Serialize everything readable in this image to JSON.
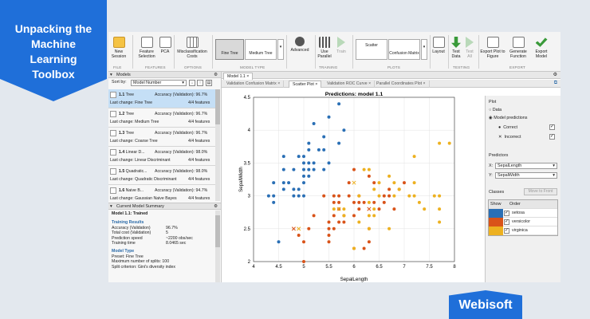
{
  "banner": {
    "title_lines": [
      "Unpacking the",
      "Machine",
      "Learning",
      "Toolbox"
    ]
  },
  "brand": {
    "name": "Webisoft"
  },
  "ribbon": {
    "buttons": {
      "new_session": "New Session",
      "feature_selection": "Feature Selection",
      "pca": "PCA",
      "misclassification_costs": "Misclassification Costs",
      "fine_tree": "Fine Tree",
      "medium_tree": "Medium Tree",
      "advanced": "Advanced",
      "use_parallel": "Use Parallel",
      "train": "Train",
      "scatter": "Scatter",
      "confusion_matrix": "Confusion Matrix",
      "layout": "Layout",
      "test_data": "Test Data",
      "test_all": "Test All",
      "export_plot": "Export Plot to Figure",
      "generate_function": "Generate Function",
      "export_model": "Export Model"
    },
    "sections": {
      "file": "FILE",
      "features": "FEATURES",
      "options": "OPTIONS",
      "model_type": "MODEL TYPE",
      "training": "TRAINING",
      "plots": "PLOTS",
      "testing": "TESTING",
      "export": "EXPORT"
    }
  },
  "models_panel": {
    "title": "Models",
    "sort_label": "Sort by:",
    "sort_value": "Model Number",
    "items": [
      {
        "id": "1.1",
        "name": "Tree",
        "accuracy": "Accuracy (Validation): 96.7%",
        "last": "Last change: Fine Tree",
        "features": "4/4 features"
      },
      {
        "id": "1.2",
        "name": "Tree",
        "accuracy": "Accuracy (Validation): 96.7%",
        "last": "Last change: Medium Tree",
        "features": "4/4 features"
      },
      {
        "id": "1.3",
        "name": "Tree",
        "accuracy": "Accuracy (Validation): 96.7%",
        "last": "Last change: Coarse Tree",
        "features": "4/4 features"
      },
      {
        "id": "1.4",
        "name": "Linear D...",
        "accuracy": "Accuracy (Validation): 98.0%",
        "last": "Last change: Linear Discriminant",
        "features": "4/4 features"
      },
      {
        "id": "1.5",
        "name": "Quadratic...",
        "accuracy": "Accuracy (Validation): 98.0%",
        "last": "Last change: Quadratic Discriminant",
        "features": "4/4 features"
      },
      {
        "id": "1.6",
        "name": "Naive B...",
        "accuracy": "Accuracy (Validation): 94.7%",
        "last": "Last change: Gaussian Naive Bayes",
        "features": "4/4 features"
      }
    ]
  },
  "summary": {
    "title": "Current Model Summary",
    "model_line": "Model 1.1: Trained",
    "training_results": "Training Results",
    "rows": [
      {
        "label": "Accuracy (Validation)",
        "value": "96.7%"
      },
      {
        "label": "Total cost (Validation)",
        "value": "5"
      },
      {
        "label": "Prediction speed",
        "value": "~2200 obs/sec"
      },
      {
        "label": "Training time",
        "value": "8.0465 sec"
      }
    ],
    "model_type": "Model Type",
    "preset": "Preset: Fine Tree",
    "max_splits": "Maximum number of splits: 100",
    "split_criterion": "Split criterion: Gini's diversity index"
  },
  "doc_tabs": {
    "model": "Model 1.1"
  },
  "plot_tabs": [
    "Validation Confusion Matrix",
    "Scatter Plot",
    "Validation ROC Curve",
    "Parallel Coordinates Plot"
  ],
  "plot_options": {
    "plot_heading": "Plot",
    "data": "Data",
    "predictions": "Model predictions",
    "correct": "Correct",
    "incorrect": "Incorrect",
    "predictors_heading": "Predictors",
    "x_label": "X:",
    "x_value": "SepalLength",
    "y_label": "Y:",
    "y_value": "SepalWidth",
    "classes_heading": "Classes",
    "move_to_front": "Move to Front",
    "show_col": "Show",
    "order_col": "Order",
    "classes": [
      "setosa",
      "versicolor",
      "virginica"
    ]
  },
  "colors": {
    "setosa": "#2a6fb5",
    "versicolor": "#d95319",
    "virginica": "#edb120"
  },
  "chart_data": {
    "type": "scatter",
    "title": "Predictions: model 1.1",
    "xlabel": "SepalLength",
    "ylabel": "SepalWidth",
    "xlim": [
      4,
      8
    ],
    "ylim": [
      2,
      4.5
    ],
    "xticks": [
      "4",
      "4.5",
      "5",
      "5.5",
      "6",
      "6.5",
      "7",
      "7.5",
      "8"
    ],
    "yticks": [
      "2",
      "2.5",
      "3",
      "3.5",
      "4",
      "4.5"
    ],
    "grid": true,
    "series": [
      {
        "name": "setosa",
        "points": [
          [
            4.3,
            3.0
          ],
          [
            4.4,
            2.9
          ],
          [
            4.4,
            3.0
          ],
          [
            4.4,
            3.2
          ],
          [
            4.5,
            2.3
          ],
          [
            4.6,
            3.1
          ],
          [
            4.6,
            3.2
          ],
          [
            4.6,
            3.4
          ],
          [
            4.6,
            3.6
          ],
          [
            4.7,
            3.2
          ],
          [
            4.8,
            3.0
          ],
          [
            4.8,
            3.1
          ],
          [
            4.8,
            3.4
          ],
          [
            4.9,
            3.0
          ],
          [
            4.9,
            3.1
          ],
          [
            4.9,
            3.6
          ],
          [
            5.0,
            3.0
          ],
          [
            5.0,
            3.2
          ],
          [
            5.0,
            3.3
          ],
          [
            5.0,
            3.4
          ],
          [
            5.0,
            3.5
          ],
          [
            5.0,
            3.6
          ],
          [
            5.1,
            3.3
          ],
          [
            5.1,
            3.4
          ],
          [
            5.1,
            3.5
          ],
          [
            5.1,
            3.7
          ],
          [
            5.1,
            3.8
          ],
          [
            5.2,
            3.4
          ],
          [
            5.2,
            3.5
          ],
          [
            5.2,
            4.1
          ],
          [
            5.3,
            3.7
          ],
          [
            5.4,
            3.4
          ],
          [
            5.4,
            3.7
          ],
          [
            5.4,
            3.9
          ],
          [
            5.5,
            3.5
          ],
          [
            5.5,
            4.2
          ],
          [
            5.7,
            3.8
          ],
          [
            5.7,
            4.4
          ],
          [
            5.8,
            4.0
          ]
        ]
      },
      {
        "name": "versicolor",
        "points": [
          [
            4.9,
            2.4
          ],
          [
            5.0,
            2.0
          ],
          [
            5.0,
            2.3
          ],
          [
            5.1,
            2.5
          ],
          [
            5.2,
            2.7
          ],
          [
            5.4,
            3.0
          ],
          [
            5.5,
            2.3
          ],
          [
            5.5,
            2.4
          ],
          [
            5.5,
            2.5
          ],
          [
            5.5,
            2.6
          ],
          [
            5.6,
            2.5
          ],
          [
            5.6,
            2.7
          ],
          [
            5.6,
            2.9
          ],
          [
            5.6,
            3.0
          ],
          [
            5.7,
            2.6
          ],
          [
            5.7,
            2.8
          ],
          [
            5.7,
            2.9
          ],
          [
            5.7,
            3.0
          ],
          [
            5.8,
            2.6
          ],
          [
            5.8,
            2.7
          ],
          [
            5.9,
            3.0
          ],
          [
            5.9,
            3.2
          ],
          [
            6.0,
            2.2
          ],
          [
            6.0,
            2.7
          ],
          [
            6.0,
            2.9
          ],
          [
            6.0,
            3.4
          ],
          [
            6.1,
            2.8
          ],
          [
            6.1,
            2.9
          ],
          [
            6.1,
            3.0
          ],
          [
            6.2,
            2.2
          ],
          [
            6.2,
            2.9
          ],
          [
            6.3,
            2.3
          ],
          [
            6.3,
            2.5
          ],
          [
            6.3,
            3.3
          ],
          [
            6.4,
            2.9
          ],
          [
            6.4,
            3.2
          ],
          [
            6.5,
            2.8
          ],
          [
            6.6,
            2.9
          ],
          [
            6.6,
            3.0
          ],
          [
            6.7,
            3.0
          ],
          [
            6.7,
            3.1
          ],
          [
            6.8,
            2.8
          ],
          [
            6.9,
            3.1
          ],
          [
            7.0,
            3.2
          ]
        ]
      },
      {
        "name": "virginica",
        "points": [
          [
            5.6,
            2.8
          ],
          [
            5.8,
            2.7
          ],
          [
            5.8,
            2.8
          ],
          [
            6.0,
            2.2
          ],
          [
            6.1,
            2.6
          ],
          [
            6.1,
            3.0
          ],
          [
            6.2,
            3.4
          ],
          [
            6.3,
            2.5
          ],
          [
            6.3,
            2.7
          ],
          [
            6.3,
            2.9
          ],
          [
            6.3,
            3.4
          ],
          [
            6.4,
            2.7
          ],
          [
            6.4,
            2.8
          ],
          [
            6.4,
            3.1
          ],
          [
            6.5,
            3.0
          ],
          [
            6.5,
            3.2
          ],
          [
            6.7,
            2.5
          ],
          [
            6.7,
            3.3
          ],
          [
            6.8,
            3.0
          ],
          [
            6.8,
            3.2
          ],
          [
            6.9,
            3.1
          ],
          [
            7.1,
            3.0
          ],
          [
            7.2,
            3.0
          ],
          [
            7.2,
            3.2
          ],
          [
            7.2,
            3.6
          ],
          [
            7.3,
            2.9
          ],
          [
            7.4,
            2.8
          ],
          [
            7.6,
            3.0
          ],
          [
            7.7,
            2.6
          ],
          [
            7.7,
            2.8
          ],
          [
            7.7,
            3.0
          ],
          [
            7.7,
            3.8
          ],
          [
            7.9,
            3.8
          ]
        ]
      }
    ],
    "incorrect": [
      {
        "cls": "versicolor",
        "x": 4.8,
        "y": 2.5
      },
      {
        "cls": "virginica",
        "x": 4.9,
        "y": 2.5
      },
      {
        "cls": "virginica",
        "x": 5.7,
        "y": 2.8
      },
      {
        "cls": "virginica",
        "x": 6.0,
        "y": 3.2
      },
      {
        "cls": "versicolor",
        "x": 6.3,
        "y": 2.8
      }
    ]
  }
}
